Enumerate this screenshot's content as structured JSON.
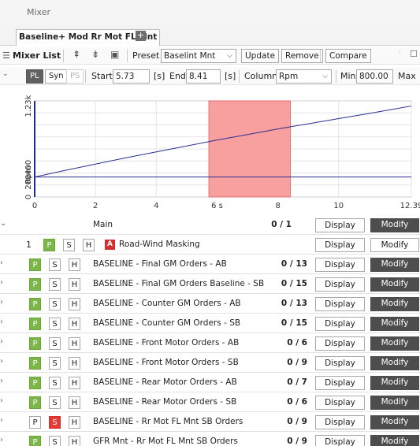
{
  "window": {
    "title": "Mixer"
  },
  "tabs": [
    {
      "label": "Baseline+ Mod Rr Mot FL Mnt"
    }
  ],
  "toolbar1": {
    "mixer_list_label": "Mixer List",
    "preset_label": "Preset",
    "preset_value": "Baselint Mnt",
    "update_label": "Update",
    "remove_label": "Remove",
    "compare_label": "Compare"
  },
  "toolbar2": {
    "pl_label": "PL",
    "syn_label": "Syn",
    "ps_label": "PS",
    "start_label": "Start",
    "start_value": "5.73",
    "start_unit": "[s]",
    "end_label": "End",
    "end_value": "8.41",
    "end_unit": "[s]",
    "column_label": "Column",
    "column_value": "Rpm",
    "min_label": "Min",
    "min_value": "800.00",
    "max_label": "Max"
  },
  "chart_data": {
    "type": "line",
    "xlabel": "",
    "ylabel": "Rpm",
    "xlim": [
      0,
      12.39
    ],
    "ylim": [
      0,
      1300
    ],
    "x_ticks": [
      "0",
      "2",
      "4",
      "6 s",
      "8",
      "10",
      "12.39"
    ],
    "y_ticks": [
      "0",
      "200",
      "400",
      "1.23k"
    ],
    "selection": {
      "start": 5.73,
      "end": 8.41,
      "color": "#f8a0a0"
    },
    "series": [
      {
        "x": [
          0,
          1,
          2,
          3,
          4,
          5,
          6,
          7,
          8,
          9,
          10,
          11,
          12.39
        ],
        "y": [
          270,
          360,
          445,
          530,
          610,
          690,
          770,
          845,
          920,
          990,
          1060,
          1130,
          1230
        ],
        "color": "#2b2f8f"
      },
      {
        "x": [
          0,
          12.39
        ],
        "y": [
          270,
          270
        ],
        "color": "#2b2f8f"
      }
    ]
  },
  "main": {
    "header": {
      "name": "Main",
      "count": "0 / 1",
      "display": "Display",
      "modify": "Modify"
    },
    "rows": [
      {
        "num": "1",
        "p": "P",
        "s": "S",
        "h": "H",
        "icon": "A",
        "name": "Road-Wind Masking",
        "count": "",
        "display": "Display",
        "modify": "Modify",
        "s_red": false,
        "p_green": true,
        "light": true
      },
      {
        "p": "P",
        "s": "S",
        "h": "H",
        "name": "BASELINE - Final GM Orders - AB",
        "count": "0 / 13",
        "display": "Display",
        "modify": "Modify",
        "s_red": false,
        "p_green": true
      },
      {
        "p": "P",
        "s": "S",
        "h": "H",
        "name": "BASELINE - Final GM Orders Baseline - SB",
        "count": "0 / 15",
        "display": "Display",
        "modify": "Modify",
        "s_red": false,
        "p_green": true
      },
      {
        "p": "P",
        "s": "S",
        "h": "H",
        "name": "BASELINE - Counter GM Orders - AB",
        "count": "0 / 13",
        "display": "Display",
        "modify": "Modify",
        "s_red": false,
        "p_green": true
      },
      {
        "p": "P",
        "s": "S",
        "h": "H",
        "name": "BASELINE - Counter GM Orders - SB",
        "count": "0 / 15",
        "display": "Display",
        "modify": "Modify",
        "s_red": false,
        "p_green": true
      },
      {
        "p": "P",
        "s": "S",
        "h": "H",
        "name": "BASELINE - Front Motor Orders - AB",
        "count": "0 / 6",
        "display": "Display",
        "modify": "Modify",
        "s_red": false,
        "p_green": true
      },
      {
        "p": "P",
        "s": "S",
        "h": "H",
        "name": "BASELINE - Front Motor Orders - SB",
        "count": "0 / 9",
        "display": "Display",
        "modify": "Modify",
        "s_red": false,
        "p_green": true
      },
      {
        "p": "P",
        "s": "S",
        "h": "H",
        "name": "BASELINE - Rear Motor Orders - AB",
        "count": "0 / 7",
        "display": "Display",
        "modify": "Modify",
        "s_red": false,
        "p_green": true
      },
      {
        "p": "P",
        "s": "S",
        "h": "H",
        "name": "BASELINE - Rear Motor Orders - SB",
        "count": "0 / 6",
        "display": "Display",
        "modify": "Modify",
        "s_red": false,
        "p_green": true
      },
      {
        "p": "P",
        "s": "S",
        "h": "H",
        "name": "BASELINE - Rr Mot FL Mnt SB Orders",
        "count": "0 / 9",
        "display": "Display",
        "modify": "Modify",
        "s_red": true,
        "p_green": false
      },
      {
        "p": "P",
        "s": "S",
        "h": "H",
        "name": "GFR Mnt - Rr Mot FL Mnt SB Orders",
        "count": "0 / 9",
        "display": "Display",
        "modify": "Modify",
        "s_red": false,
        "p_green": true
      }
    ]
  },
  "colors": {
    "accent_green": "#7ab648",
    "solo_red": "#e53935",
    "modify_bg": "#4d4d4d",
    "line": "#2b2f8f"
  }
}
